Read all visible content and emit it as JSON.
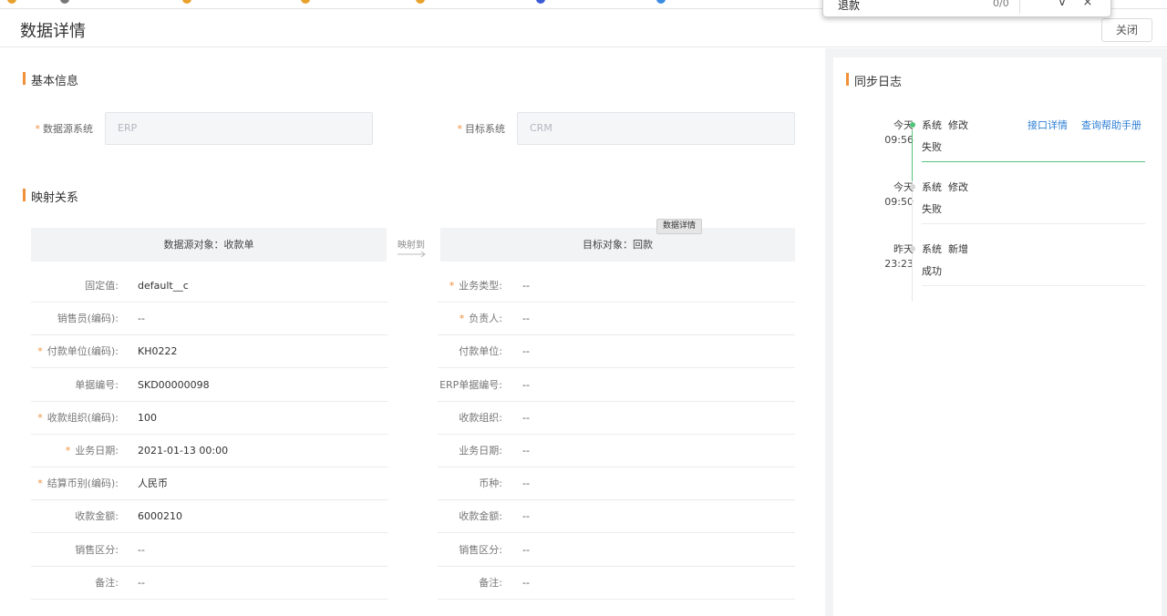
{
  "header": {
    "title": "数据详情",
    "close_label": "关闭"
  },
  "find_bar": {
    "query": "退款",
    "count": "0/0",
    "prev_icon": "^",
    "next_icon": "v",
    "close_icon": "×"
  },
  "basic": {
    "title": "基本信息",
    "source_label": "数据源系统",
    "source_value": "ERP",
    "target_label": "目标系统",
    "target_value": "CRM"
  },
  "mapping": {
    "title": "映射关系",
    "source_object": "数据源对象：收款单",
    "target_object": "目标对象：回款",
    "map_to": "映射到",
    "tooltip": "数据详情"
  },
  "source_rows": [
    {
      "label": "固定值:",
      "value": "default__c",
      "required": false
    },
    {
      "label": "销售员(编码):",
      "value": "--",
      "required": false
    },
    {
      "label": "付款单位(编码):",
      "value": "KH0222",
      "required": true
    },
    {
      "label": "单据编号:",
      "value": "SKD00000098",
      "required": false
    },
    {
      "label": "收款组织(编码):",
      "value": "100",
      "required": true
    },
    {
      "label": "业务日期:",
      "value": "2021-01-13 00:00",
      "required": true
    },
    {
      "label": "结算币别(编码):",
      "value": "人民币",
      "required": true
    },
    {
      "label": "收款金额:",
      "value": "6000210",
      "required": false
    },
    {
      "label": "销售区分:",
      "value": "--",
      "required": false
    },
    {
      "label": "备注:",
      "value": "--",
      "required": false
    }
  ],
  "target_rows": [
    {
      "label": "业务类型:",
      "value": "--",
      "required": true,
      "link": false
    },
    {
      "label": "负责人:",
      "value": "--",
      "required": true,
      "link": false
    },
    {
      "label": "付款单位:",
      "value": "--",
      "required": false,
      "link": true
    },
    {
      "label": "ERP单据编号:",
      "value": "--",
      "required": false,
      "link": false
    },
    {
      "label": "收款组织:",
      "value": "--",
      "required": false,
      "link": true
    },
    {
      "label": "业务日期:",
      "value": "--",
      "required": false,
      "link": false
    },
    {
      "label": "币种:",
      "value": "--",
      "required": false,
      "link": false
    },
    {
      "label": "收款金额:",
      "value": "--",
      "required": false,
      "link": false
    },
    {
      "label": "销售区分:",
      "value": "--",
      "required": false,
      "link": false
    },
    {
      "label": "备注:",
      "value": "--",
      "required": false,
      "link": false
    }
  ],
  "sync_log": {
    "title": "同步日志",
    "interface_detail": "接口详情",
    "help_manual": "查询帮助手册",
    "entries": [
      {
        "day": "今天",
        "time": "09:56",
        "actor": "系统",
        "action": "修改",
        "status": "失败",
        "active": true
      },
      {
        "day": "今天",
        "time": "09:50",
        "actor": "系统",
        "action": "修改",
        "status": "失败",
        "active": false
      },
      {
        "day": "昨天",
        "time": "23:23",
        "actor": "系统",
        "action": "新增",
        "status": "成功",
        "active": false
      }
    ]
  },
  "colors": {
    "accent": "#f0913a",
    "link": "#2f7fd6",
    "success_green": "#52c47a"
  }
}
